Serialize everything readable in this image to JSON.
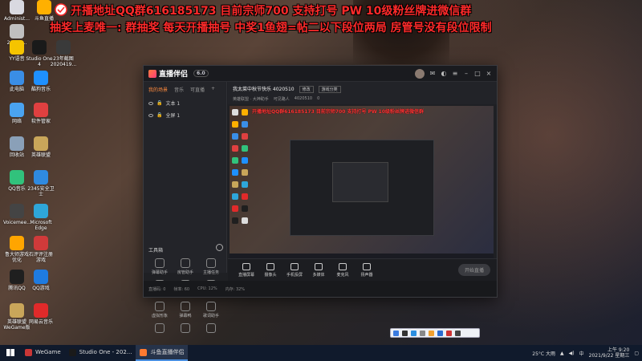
{
  "overlay": {
    "line1": "开播地址QQ群616185173    目前宗师700   支持打号 PW   10级粉丝牌进微信群",
    "line2": "抽奖上麦唯一: 群抽奖      每天开播抽号      中奖1鱼翅=帖二以下段位两局      房管号没有段位限制"
  },
  "desktop_icons": [
    {
      "label": "Administ...",
      "color": "#d9d9e0"
    },
    {
      "label": "斗鱼直播",
      "color": "#ffb000"
    },
    {
      "label": "20200...",
      "color": "#c0c0c0"
    },
    {
      "label": "YY语音",
      "color": "#f5c400"
    },
    {
      "label": "Studio One 4",
      "color": "#1a1a1a"
    },
    {
      "label": "23年截图 2020419...",
      "color": "#3a3a3a"
    },
    {
      "label": "此电脑",
      "color": "#3a8ee6"
    },
    {
      "label": "酷狗音乐",
      "color": "#1e90ff"
    },
    {
      "label": "网络",
      "color": "#4aa3f0"
    },
    {
      "label": "软件管家",
      "color": "#e04040"
    },
    {
      "label": "回收站",
      "color": "#8aa0b8"
    },
    {
      "label": "英雄联盟",
      "color": "#c9a65a"
    },
    {
      "label": "QQ音乐",
      "color": "#31c27c"
    },
    {
      "label": "2345安全卫士",
      "color": "#2f8ae0"
    },
    {
      "label": "Voicemee...",
      "color": "#444"
    },
    {
      "label": "Microsoft Edge",
      "color": "#2ea6d9"
    },
    {
      "label": "鲁大师游戏优化",
      "color": "#ffa500"
    },
    {
      "label": "石评评注册游戏",
      "color": "#d03a3a"
    },
    {
      "label": "腾讯QQ",
      "color": "#1f1f1f"
    },
    {
      "label": "QQ游戏",
      "color": "#1e7be0"
    },
    {
      "label": "英雄联盟 WeGame版",
      "color": "#c9a65a"
    },
    {
      "label": "网易云音乐",
      "color": "#e02a2a"
    }
  ],
  "app": {
    "name": "直播伴侣",
    "version": "6.0",
    "tabs": [
      "我的场景",
      "音乐",
      "可直播"
    ],
    "sources": [
      "文本 1",
      "全屏 1"
    ],
    "tools_header": "工具箱",
    "tools": [
      "弹幕助手",
      "房管助手",
      "主播任务",
      "视频连麦",
      "多人连麦",
      "观看弹幕",
      "虚拟形象",
      "弹幕鸭",
      "歌词助手",
      "",
      "",
      ""
    ],
    "room_title": "我太菜中秋节快乐 4020510",
    "edit_label": "修改",
    "category_label": "游戏分类",
    "info_row": [
      "英雄联盟 · 大神助手",
      "可见路人",
      "4020510",
      "0"
    ],
    "nested_overlay": "开播地址QQ群616185173   目前宗师700  支持打号 PW  10级粉丝牌进微信群",
    "toolbar": [
      "直播屏幕",
      "摄像头",
      "手机投屏",
      "多媒体",
      "麦克风",
      "扬声器"
    ],
    "start_label": "开始直播",
    "status": [
      "直播码: 0",
      "帧率: 60",
      "CPU: 12%",
      "内存: 32%"
    ]
  },
  "taskbar": {
    "apps": [
      {
        "label": "WeGame",
        "color": "#c93636"
      },
      {
        "label": "Studio One - 202...",
        "color": "#1a1a1a"
      },
      {
        "label": "斗鱼直播伴侣",
        "color": "#ff7a30"
      }
    ],
    "weather": "25°C 大雨",
    "lang": "中",
    "time": "上午 9:20",
    "date": "2021/9/22 星期三"
  }
}
